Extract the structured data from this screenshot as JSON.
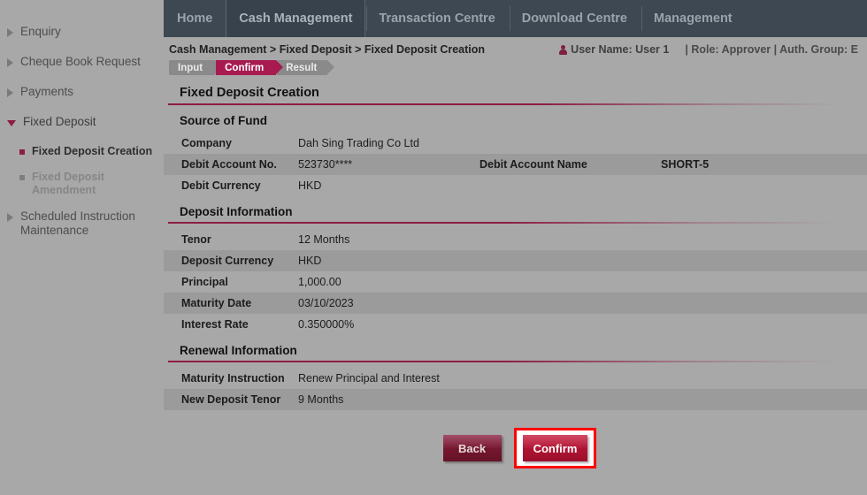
{
  "sidebar": {
    "items": [
      {
        "label": "Enquiry",
        "state": "collapsed",
        "icon": "chevron-right-icon"
      },
      {
        "label": "Cheque Book Request",
        "state": "collapsed",
        "icon": "chevron-right-icon"
      },
      {
        "label": "Payments",
        "state": "collapsed",
        "icon": "chevron-right-icon"
      },
      {
        "label": "Fixed Deposit",
        "state": "expanded",
        "icon": "chevron-down-icon"
      }
    ],
    "sub_items": [
      {
        "label": "Fixed Deposit Creation",
        "state": "active",
        "icon": "bullet-square-icon"
      },
      {
        "label": "Fixed Deposit Amendment",
        "state": "disabled",
        "icon": "bullet-square-icon"
      }
    ],
    "trailing_items": [
      {
        "label": "Scheduled Instruction Maintenance",
        "state": "collapsed",
        "icon": "chevron-right-icon"
      }
    ]
  },
  "topnav": {
    "tabs": [
      {
        "label": "Home",
        "active": false
      },
      {
        "label": "Cash Management",
        "active": true
      },
      {
        "label": "Transaction Centre",
        "active": false
      },
      {
        "label": "Download Centre",
        "active": false
      },
      {
        "label": "Management",
        "active": false
      }
    ]
  },
  "header": {
    "breadcrumb": "Cash Management > Fixed Deposit > Fixed Deposit Creation",
    "user_name": "User Name: User 1",
    "role": "| Role: Approver | Auth. Group: E",
    "user_icon": "user-icon"
  },
  "steps": [
    {
      "label": "Input",
      "active": false
    },
    {
      "label": "Confirm",
      "active": true
    },
    {
      "label": "Result",
      "active": false
    }
  ],
  "page": {
    "title": "Fixed Deposit Creation"
  },
  "sections": [
    {
      "title": "Source of Fund",
      "rows": [
        {
          "label": "Company",
          "value": "Dah Sing Trading Co Ltd",
          "alt": false
        },
        {
          "label": "Debit Account No.",
          "value": "523730****",
          "label2": "Debit Account Name",
          "value2": "SHORT-5",
          "alt": true
        },
        {
          "label": "Debit Currency",
          "value": "HKD",
          "alt": false
        }
      ]
    },
    {
      "title": "Deposit Information",
      "rows": [
        {
          "label": "Tenor",
          "value": "12 Months",
          "alt": false
        },
        {
          "label": "Deposit Currency",
          "value": "HKD",
          "alt": true
        },
        {
          "label": "Principal",
          "value": "1,000.00",
          "alt": false
        },
        {
          "label": "Maturity Date",
          "value": "03/10/2023",
          "alt": true
        },
        {
          "label": "Interest Rate",
          "value": "0.350000%",
          "alt": false
        }
      ]
    },
    {
      "title": "Renewal Information",
      "rows": [
        {
          "label": "Maturity Instruction",
          "value": "Renew Principal and Interest",
          "alt": false
        },
        {
          "label": "New Deposit Tenor",
          "value": "9 Months",
          "alt": true
        }
      ]
    }
  ],
  "buttons": {
    "back": "Back",
    "confirm": "Confirm"
  },
  "colors": {
    "page_background": "#a8a8a8",
    "nav_background": "#3d4852",
    "accent_crimson": "#8c1d43",
    "step_active": "#a81b51",
    "confirm_button": "#b01433",
    "back_button": "#76172f",
    "highlight_box": "#ff0000",
    "row_alt": "#9b9b9b"
  }
}
